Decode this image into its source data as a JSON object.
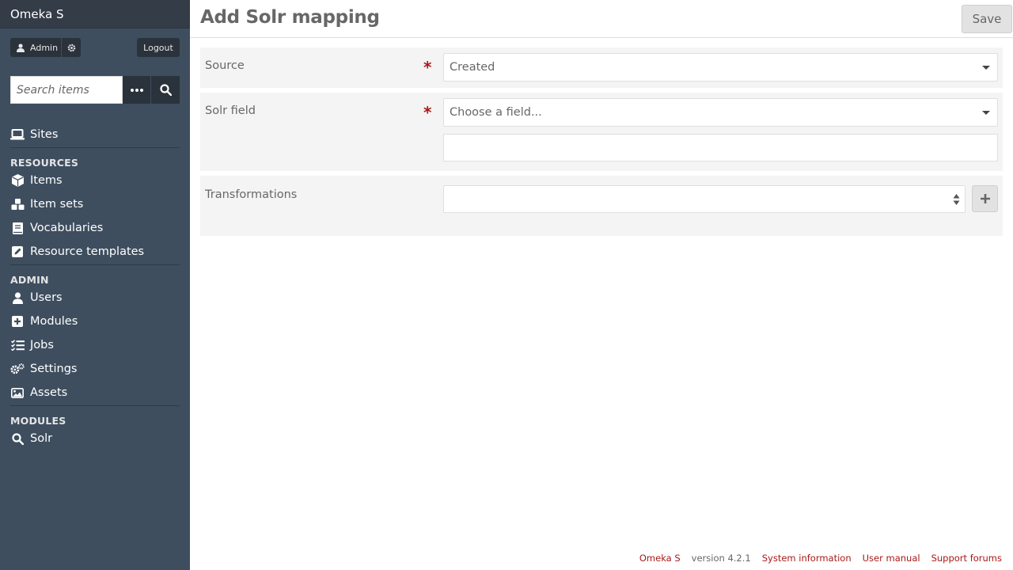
{
  "app": {
    "brand": "Omeka S"
  },
  "user": {
    "name": "Admin",
    "logout_label": "Logout"
  },
  "search": {
    "placeholder": "Search items"
  },
  "nav": {
    "sites": "Sites",
    "resources_head": "RESOURCES",
    "items": "Items",
    "item_sets": "Item sets",
    "vocabularies": "Vocabularies",
    "resource_templates": "Resource templates",
    "admin_head": "ADMIN",
    "users": "Users",
    "modules": "Modules",
    "jobs": "Jobs",
    "settings": "Settings",
    "assets": "Assets",
    "modules_head": "MODULES",
    "solr": "Solr"
  },
  "page": {
    "title": "Add Solr mapping",
    "save_label": "Save"
  },
  "form": {
    "source": {
      "label": "Source",
      "value": "Created",
      "required": true
    },
    "solr_field": {
      "label": "Solr field",
      "value": "Choose a field...",
      "required": true,
      "custom_value": ""
    },
    "transformations": {
      "label": "Transformations"
    }
  },
  "footer": {
    "brand_link": "Omeka S",
    "version": "version 4.2.1",
    "system_info": "System information",
    "user_manual": "User manual",
    "support_forums": "Support forums"
  },
  "colors": {
    "sidebar": "#3e4e5f",
    "sidebar_dark": "#2a323b",
    "accent": "#a91919",
    "text": "#676767"
  }
}
